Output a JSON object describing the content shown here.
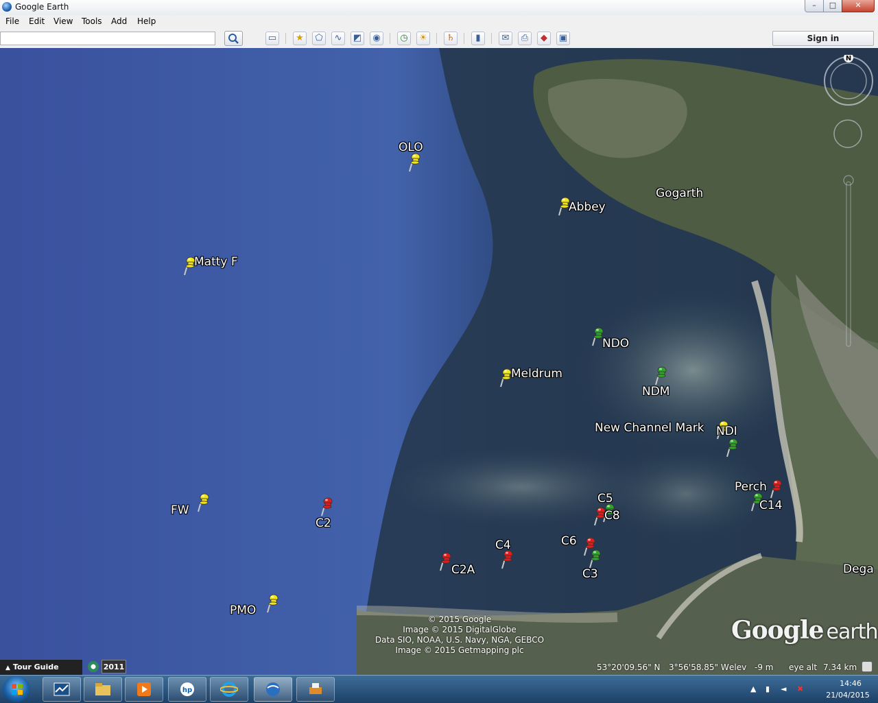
{
  "window": {
    "title": "Google Earth",
    "min": "–",
    "max": "□",
    "close": "✕"
  },
  "menu": [
    "File",
    "Edit",
    "View",
    "Tools",
    "Add",
    "Help"
  ],
  "search": {
    "value": "",
    "placeholder": ""
  },
  "toolbar": {
    "signin_label": "Sign in",
    "tools": [
      "sidebar-icon",
      "placemark-icon",
      "polygon-icon",
      "path-icon",
      "image-overlay-icon",
      "record-tour-icon",
      "historical-imagery-icon",
      "sunlight-icon",
      "planets-icon",
      "ruler-icon",
      "email-icon",
      "print-icon",
      "view-in-maps-icon",
      "save-image-icon"
    ]
  },
  "map": {
    "placemarks": [
      {
        "label": "OLO",
        "color": "yellow"
      },
      {
        "label": "Abbey",
        "color": "yellow"
      },
      {
        "label": "Matty F",
        "color": "yellow"
      },
      {
        "label": "Meldrum",
        "color": "yellow"
      },
      {
        "label": "FW",
        "color": "yellow"
      },
      {
        "label": "PMO",
        "color": "yellow"
      },
      {
        "label": "NDO",
        "color": "green"
      },
      {
        "label": "NDM",
        "color": "green"
      },
      {
        "label": "New Channel Mark",
        "color": "yellow"
      },
      {
        "label": "NDI",
        "color": "green"
      },
      {
        "label": "Perch",
        "color": "red"
      },
      {
        "label": "C14",
        "color": "green"
      },
      {
        "label": "C2",
        "color": "red"
      },
      {
        "label": "C2A",
        "color": "red"
      },
      {
        "label": "C4",
        "color": "red"
      },
      {
        "label": "C5",
        "color": "green"
      },
      {
        "label": "C8",
        "color": "red"
      },
      {
        "label": "C6",
        "color": "red"
      },
      {
        "label": "C3",
        "color": "green"
      }
    ],
    "place_labels": [
      "Gogarth",
      "Dega"
    ],
    "compass_north": "N",
    "copyright": [
      "© 2015 Google",
      "Image © 2015 DigitalGlobe",
      "Data SIO, NOAA, U.S. Navy, NGA, GEBCO",
      "Image © 2015 Getmapping plc"
    ],
    "logo_main": "Google",
    "logo_sub": "earth"
  },
  "status": {
    "tour_guide": "Tour Guide",
    "year": "2011",
    "lat": "53°20'09.56\" N",
    "lon": "3°56'58.85\" W",
    "elev_label": "elev",
    "elev_value": "-9 m",
    "eye_alt_label": "eye alt",
    "eye_alt_value": "7.34 km"
  },
  "taskbar": {
    "apps": [
      "task-manager-icon",
      "file-explorer-icon",
      "media-player-icon",
      "hp-icon",
      "internet-explorer-icon",
      "google-earth-icon",
      "printer-app-icon"
    ],
    "time": "14:46",
    "date": "21/04/2015"
  },
  "colors": {
    "pin_yellow": "#f2e51a",
    "pin_green": "#2fa52a",
    "pin_red": "#e31b1b",
    "ocean": "#3f58a3",
    "tidal": "#243a55"
  }
}
